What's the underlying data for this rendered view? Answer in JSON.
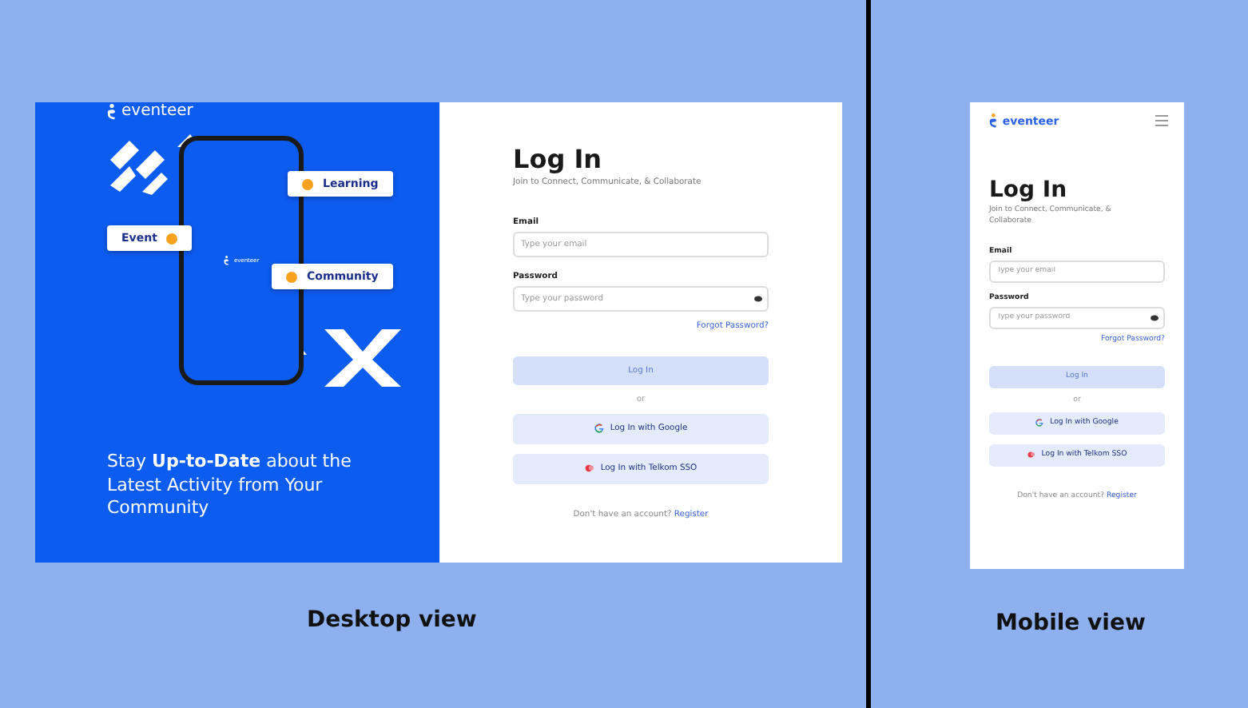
{
  "desktop": {
    "brand": "eventeer",
    "phone_brand": "eventeer",
    "chips": [
      {
        "label": "Learning"
      },
      {
        "label": "Event"
      },
      {
        "label": "Community"
      }
    ],
    "tagline": "Stay **Up-to-Date** about the Latest Activity from Your Community",
    "form": {
      "title": "Log In",
      "subtitle": "Join to Connect, Communicate, & Collaborate",
      "email_label": "Email",
      "email_placeholder": "Type your email",
      "password_label": "Password",
      "password_placeholder": "Type your password",
      "forgot": "Forgot Password?",
      "login": {
        "label": "Log In",
        "disabled": true
      },
      "or": "or",
      "google": "Log In with Google",
      "sso": "Log In with Telkom SSO",
      "register_prompt": "Don't have an account?",
      "register": "Register"
    },
    "caption": "Desktop view"
  },
  "mobile": {
    "brand": "eventeer",
    "form": {
      "title": "Log In",
      "subtitle": "Join to Connect, Communicate, & Collaborate",
      "email_label": "Email",
      "email_placeholder": "Type your email",
      "password_label": "Password",
      "password_placeholder": "Type your password",
      "forgot": "Forgot Password?",
      "login": {
        "label": "Log In",
        "disabled": true
      },
      "or": "or",
      "google": "Log In with Google",
      "sso": "Log In with Telkom SSO",
      "register_prompt": "Don't have an account?",
      "register": "Register"
    },
    "caption": "Mobile view"
  }
}
